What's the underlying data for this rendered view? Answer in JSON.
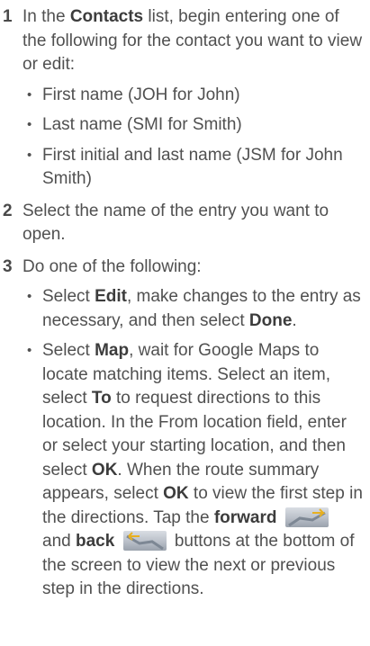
{
  "steps": [
    {
      "number": "1",
      "parts": [
        {
          "t": "In the "
        },
        {
          "t": "Contacts",
          "b": true
        },
        {
          "t": " list, begin entering one of the following for the contact you want to view or edit:"
        }
      ],
      "bullets": [
        [
          {
            "t": "First name (JOH for John)"
          }
        ],
        [
          {
            "t": "Last name (SMI for Smith)"
          }
        ],
        [
          {
            "t": "First initial and last name (JSM for John Smith)"
          }
        ]
      ]
    },
    {
      "number": "2",
      "parts": [
        {
          "t": "Select the name of the entry you want to open."
        }
      ],
      "bullets": []
    },
    {
      "number": "3",
      "parts": [
        {
          "t": "Do one of the following:"
        }
      ],
      "bullets": [
        [
          {
            "t": "Select "
          },
          {
            "t": "Edit",
            "b": true
          },
          {
            "t": ", make changes to the entry as necessary, and then select "
          },
          {
            "t": "Done",
            "b": true
          },
          {
            "t": "."
          }
        ],
        [
          {
            "t": "Select "
          },
          {
            "t": "Map",
            "b": true
          },
          {
            "t": ", wait for Google Maps to locate matching items. Select an item, select "
          },
          {
            "t": "To",
            "b": true
          },
          {
            "t": " to request directions to this location. In the From location field, enter or select your starting location, and then select "
          },
          {
            "t": "OK",
            "b": true
          },
          {
            "t": ". When the route summary appears, select "
          },
          {
            "t": "OK",
            "b": true
          },
          {
            "t": " to view the first step in the directions. Tap the "
          },
          {
            "t": "forward",
            "b": true
          },
          {
            "t": " "
          },
          {
            "icon": "forward-button-icon"
          },
          {
            "t": " and "
          },
          {
            "t": "back",
            "b": true
          },
          {
            "t": " "
          },
          {
            "icon": "back-button-icon"
          },
          {
            "t": " buttons at the bottom of the screen to view the next or previous step in the directions."
          }
        ]
      ]
    }
  ],
  "colors": {
    "text": "#505050",
    "bold_text": "#3c3c3c"
  }
}
